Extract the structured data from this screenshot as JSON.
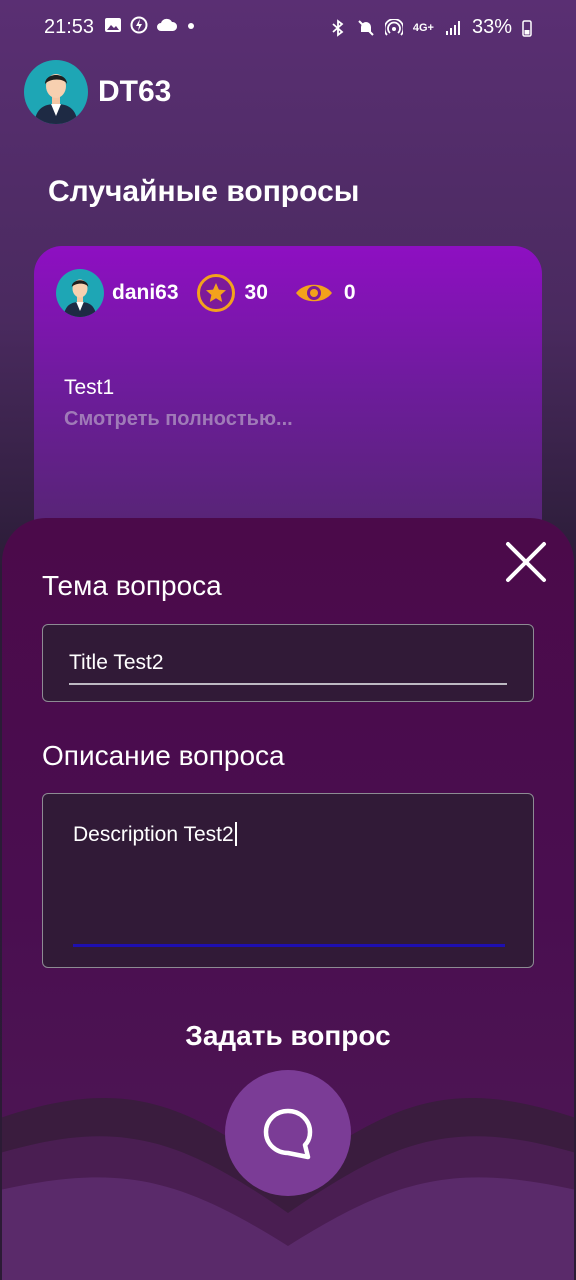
{
  "status": {
    "time": "21:53",
    "battery": "33%",
    "icons_left": [
      "gallery-icon",
      "data-saver-icon",
      "cloud-icon",
      "dot-icon"
    ],
    "icons_right": [
      "bluetooth-icon",
      "mute-icon",
      "hotspot-icon",
      "lte-icon",
      "signal-icon",
      "battery-icon"
    ],
    "lte_label": "4G+"
  },
  "header": {
    "title": "DT63"
  },
  "section": {
    "title": "Случайные вопросы"
  },
  "card": {
    "username": "dani63",
    "rating": "30",
    "views": "0",
    "text": "Test1",
    "more": "Смотреть полностью..."
  },
  "form": {
    "topic_label": "Тема вопроса",
    "topic_value": "Title Test2",
    "desc_label": "Описание вопроса",
    "desc_value": "Description Test2",
    "submit_label": "Задать вопрос"
  },
  "colors": {
    "accent": "#f3a21c",
    "card": "#8e0fc2",
    "sheet": "#4b0a4a",
    "avatar": "#1ea6b5"
  }
}
